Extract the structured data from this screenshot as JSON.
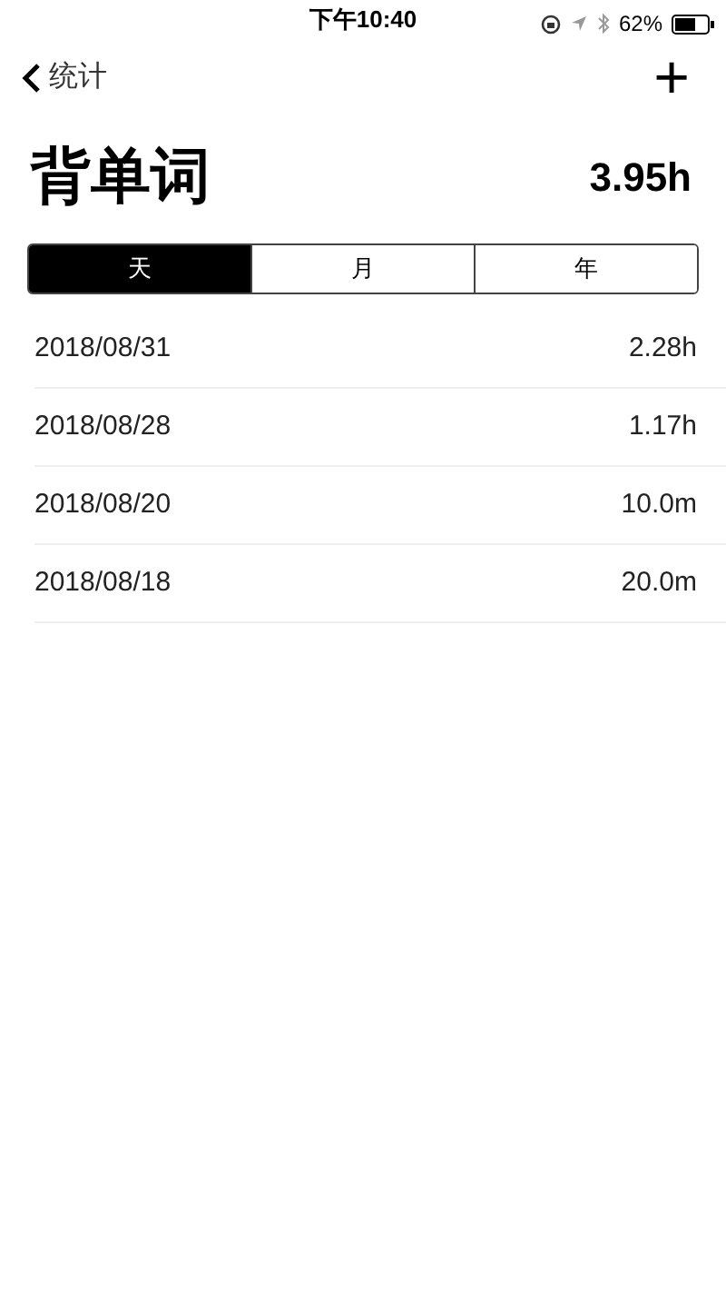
{
  "status_bar": {
    "time": "下午10:40",
    "battery": "62%"
  },
  "nav": {
    "back_label": "统计",
    "add": "+"
  },
  "header": {
    "title": "背单词",
    "total": "3.95h"
  },
  "segments": [
    {
      "label": "天",
      "selected": true
    },
    {
      "label": "月",
      "selected": false
    },
    {
      "label": "年",
      "selected": false
    }
  ],
  "records": [
    {
      "date": "2018/08/31",
      "duration": "2.28h"
    },
    {
      "date": "2018/08/28",
      "duration": "1.17h"
    },
    {
      "date": "2018/08/20",
      "duration": "10.0m"
    },
    {
      "date": "2018/08/18",
      "duration": "20.0m"
    }
  ]
}
